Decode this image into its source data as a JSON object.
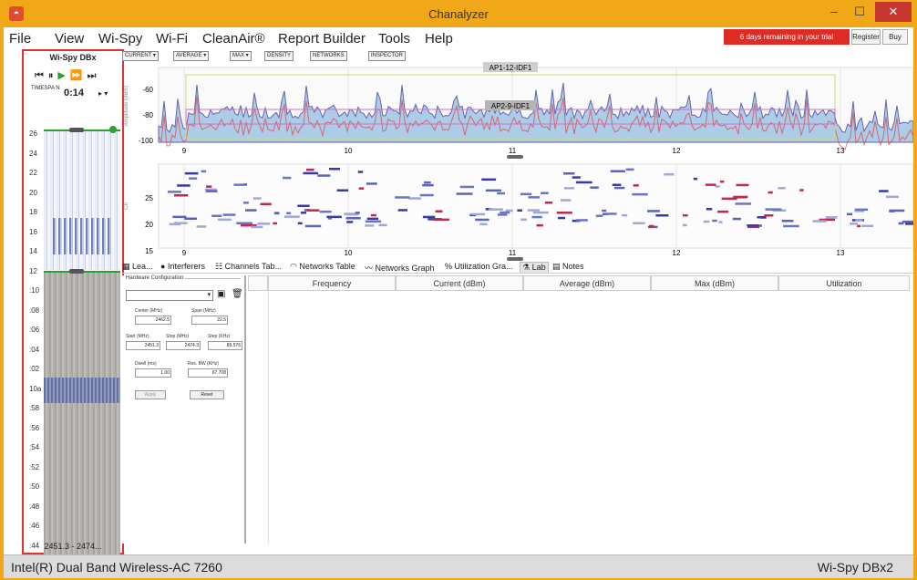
{
  "window": {
    "title": "Chanalyzer"
  },
  "menu": [
    "File",
    "View",
    "Wi-Spy",
    "Wi-Fi",
    "CleanAir®",
    "Report Builder",
    "Tools",
    "Help"
  ],
  "trial": {
    "text": "6 days remaining in your trial",
    "register": "Register",
    "buy": "Buy"
  },
  "left_panel": {
    "title": "Wi-Spy DBx",
    "timespan_label": "TIMESPA N",
    "time_value": "0:14",
    "time_controls": "▸ ▾",
    "ticks": [
      "26",
      "24",
      "22",
      "20",
      "18",
      "16",
      "14",
      "12",
      ":10",
      ":08",
      ":06",
      ":04",
      ":02",
      "10a",
      ":58",
      ":56",
      ":54",
      ":52",
      ":50",
      ":48",
      ":46",
      ":44"
    ],
    "time_marker": "10a",
    "footer": "2451.3 - 2474..."
  },
  "toolbar": [
    "CURRENT ▾",
    "AVERAGE ▾",
    "MAX ▾",
    "DENSITY",
    "NETWORKS",
    "INSPECTOR"
  ],
  "charts": {
    "top_ylabel": "Amplitude (dBm)",
    "top_yticks": [
      "-60",
      "-80",
      "-100"
    ],
    "bottom_ylabel": "Ch",
    "bottom_yticks": [
      "25",
      "20",
      "15"
    ],
    "xticks": [
      "9",
      "10",
      "11",
      "12",
      "13"
    ],
    "annotations": [
      "AP1-12-IDF1",
      "AP2-9-IDF1"
    ]
  },
  "tabs": [
    "Lea...",
    "Interferers",
    "Channels Tab...",
    "Networks Table",
    "Networks Graph",
    "Utilization Gra...",
    "Lab",
    "Notes"
  ],
  "hardware": {
    "legend": "Hardware Configuration",
    "center_label": "Center (MHz)",
    "center_value": "2462.5",
    "span_label": "Span (MHz)",
    "span_value": "22.5",
    "start_label": "Start (MHz)",
    "start_value": "2451.3",
    "stop_label": "Stop (MHz)",
    "stop_value": "2474.3",
    "step_label": "Step (KHz)",
    "step_value": "89.576",
    "dwell_label": "Dwell (ms)",
    "dwell_value": "1.00",
    "resbw_label": "Res. BW (KHz)",
    "resbw_value": "67.708",
    "apply": "Apply",
    "reset": "Reset"
  },
  "table": {
    "columns": [
      "Frequency",
      "Current (dBm)",
      "Average (dBm)",
      "Max (dBm)",
      "Utilization"
    ]
  },
  "status": {
    "left": "Intel(R) Dual Band Wireless-AC 7260",
    "right": "Wi-Spy DBx2"
  }
}
